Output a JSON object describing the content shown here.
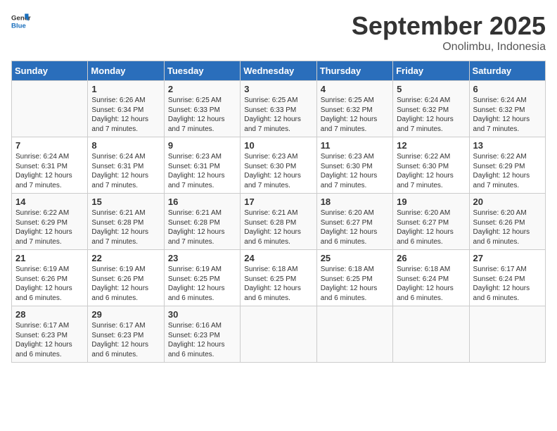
{
  "header": {
    "logo_general": "General",
    "logo_blue": "Blue",
    "month_year": "September 2025",
    "location": "Onolimbu, Indonesia"
  },
  "columns": [
    "Sunday",
    "Monday",
    "Tuesday",
    "Wednesday",
    "Thursday",
    "Friday",
    "Saturday"
  ],
  "weeks": [
    [
      {
        "day": "",
        "sunrise": "",
        "sunset": "",
        "daylight": ""
      },
      {
        "day": "1",
        "sunrise": "Sunrise: 6:26 AM",
        "sunset": "Sunset: 6:34 PM",
        "daylight": "Daylight: 12 hours and 7 minutes."
      },
      {
        "day": "2",
        "sunrise": "Sunrise: 6:25 AM",
        "sunset": "Sunset: 6:33 PM",
        "daylight": "Daylight: 12 hours and 7 minutes."
      },
      {
        "day": "3",
        "sunrise": "Sunrise: 6:25 AM",
        "sunset": "Sunset: 6:33 PM",
        "daylight": "Daylight: 12 hours and 7 minutes."
      },
      {
        "day": "4",
        "sunrise": "Sunrise: 6:25 AM",
        "sunset": "Sunset: 6:32 PM",
        "daylight": "Daylight: 12 hours and 7 minutes."
      },
      {
        "day": "5",
        "sunrise": "Sunrise: 6:24 AM",
        "sunset": "Sunset: 6:32 PM",
        "daylight": "Daylight: 12 hours and 7 minutes."
      },
      {
        "day": "6",
        "sunrise": "Sunrise: 6:24 AM",
        "sunset": "Sunset: 6:32 PM",
        "daylight": "Daylight: 12 hours and 7 minutes."
      }
    ],
    [
      {
        "day": "7",
        "sunrise": "Sunrise: 6:24 AM",
        "sunset": "Sunset: 6:31 PM",
        "daylight": "Daylight: 12 hours and 7 minutes."
      },
      {
        "day": "8",
        "sunrise": "Sunrise: 6:24 AM",
        "sunset": "Sunset: 6:31 PM",
        "daylight": "Daylight: 12 hours and 7 minutes."
      },
      {
        "day": "9",
        "sunrise": "Sunrise: 6:23 AM",
        "sunset": "Sunset: 6:31 PM",
        "daylight": "Daylight: 12 hours and 7 minutes."
      },
      {
        "day": "10",
        "sunrise": "Sunrise: 6:23 AM",
        "sunset": "Sunset: 6:30 PM",
        "daylight": "Daylight: 12 hours and 7 minutes."
      },
      {
        "day": "11",
        "sunrise": "Sunrise: 6:23 AM",
        "sunset": "Sunset: 6:30 PM",
        "daylight": "Daylight: 12 hours and 7 minutes."
      },
      {
        "day": "12",
        "sunrise": "Sunrise: 6:22 AM",
        "sunset": "Sunset: 6:30 PM",
        "daylight": "Daylight: 12 hours and 7 minutes."
      },
      {
        "day": "13",
        "sunrise": "Sunrise: 6:22 AM",
        "sunset": "Sunset: 6:29 PM",
        "daylight": "Daylight: 12 hours and 7 minutes."
      }
    ],
    [
      {
        "day": "14",
        "sunrise": "Sunrise: 6:22 AM",
        "sunset": "Sunset: 6:29 PM",
        "daylight": "Daylight: 12 hours and 7 minutes."
      },
      {
        "day": "15",
        "sunrise": "Sunrise: 6:21 AM",
        "sunset": "Sunset: 6:28 PM",
        "daylight": "Daylight: 12 hours and 7 minutes."
      },
      {
        "day": "16",
        "sunrise": "Sunrise: 6:21 AM",
        "sunset": "Sunset: 6:28 PM",
        "daylight": "Daylight: 12 hours and 7 minutes."
      },
      {
        "day": "17",
        "sunrise": "Sunrise: 6:21 AM",
        "sunset": "Sunset: 6:28 PM",
        "daylight": "Daylight: 12 hours and 6 minutes."
      },
      {
        "day": "18",
        "sunrise": "Sunrise: 6:20 AM",
        "sunset": "Sunset: 6:27 PM",
        "daylight": "Daylight: 12 hours and 6 minutes."
      },
      {
        "day": "19",
        "sunrise": "Sunrise: 6:20 AM",
        "sunset": "Sunset: 6:27 PM",
        "daylight": "Daylight: 12 hours and 6 minutes."
      },
      {
        "day": "20",
        "sunrise": "Sunrise: 6:20 AM",
        "sunset": "Sunset: 6:26 PM",
        "daylight": "Daylight: 12 hours and 6 minutes."
      }
    ],
    [
      {
        "day": "21",
        "sunrise": "Sunrise: 6:19 AM",
        "sunset": "Sunset: 6:26 PM",
        "daylight": "Daylight: 12 hours and 6 minutes."
      },
      {
        "day": "22",
        "sunrise": "Sunrise: 6:19 AM",
        "sunset": "Sunset: 6:26 PM",
        "daylight": "Daylight: 12 hours and 6 minutes."
      },
      {
        "day": "23",
        "sunrise": "Sunrise: 6:19 AM",
        "sunset": "Sunset: 6:25 PM",
        "daylight": "Daylight: 12 hours and 6 minutes."
      },
      {
        "day": "24",
        "sunrise": "Sunrise: 6:18 AM",
        "sunset": "Sunset: 6:25 PM",
        "daylight": "Daylight: 12 hours and 6 minutes."
      },
      {
        "day": "25",
        "sunrise": "Sunrise: 6:18 AM",
        "sunset": "Sunset: 6:25 PM",
        "daylight": "Daylight: 12 hours and 6 minutes."
      },
      {
        "day": "26",
        "sunrise": "Sunrise: 6:18 AM",
        "sunset": "Sunset: 6:24 PM",
        "daylight": "Daylight: 12 hours and 6 minutes."
      },
      {
        "day": "27",
        "sunrise": "Sunrise: 6:17 AM",
        "sunset": "Sunset: 6:24 PM",
        "daylight": "Daylight: 12 hours and 6 minutes."
      }
    ],
    [
      {
        "day": "28",
        "sunrise": "Sunrise: 6:17 AM",
        "sunset": "Sunset: 6:23 PM",
        "daylight": "Daylight: 12 hours and 6 minutes."
      },
      {
        "day": "29",
        "sunrise": "Sunrise: 6:17 AM",
        "sunset": "Sunset: 6:23 PM",
        "daylight": "Daylight: 12 hours and 6 minutes."
      },
      {
        "day": "30",
        "sunrise": "Sunrise: 6:16 AM",
        "sunset": "Sunset: 6:23 PM",
        "daylight": "Daylight: 12 hours and 6 minutes."
      },
      {
        "day": "",
        "sunrise": "",
        "sunset": "",
        "daylight": ""
      },
      {
        "day": "",
        "sunrise": "",
        "sunset": "",
        "daylight": ""
      },
      {
        "day": "",
        "sunrise": "",
        "sunset": "",
        "daylight": ""
      },
      {
        "day": "",
        "sunrise": "",
        "sunset": "",
        "daylight": ""
      }
    ]
  ]
}
